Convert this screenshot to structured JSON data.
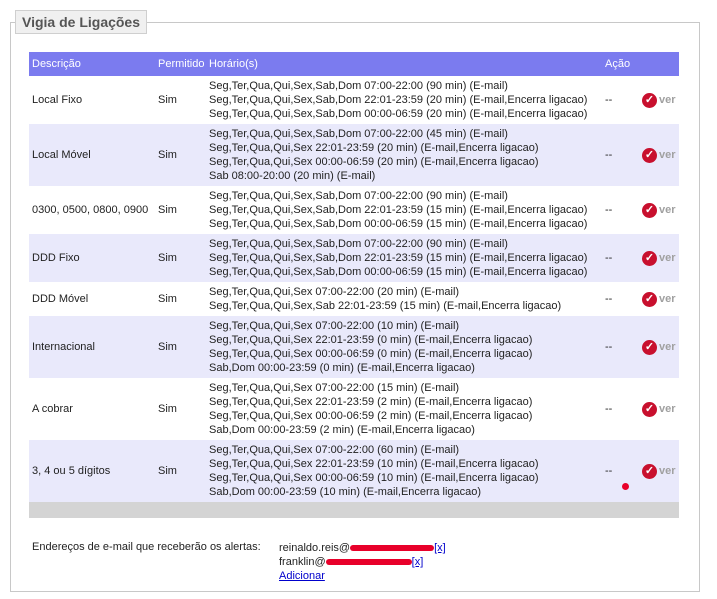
{
  "title": "Vigia de Ligações",
  "headers": {
    "descricao": "Descrição",
    "permitido": "Permitido",
    "horarios": "Horário(s)",
    "acao": "Ação"
  },
  "rows": [
    {
      "desc": "Local Fixo",
      "perm": "Sim",
      "h": [
        "Seg,Ter,Qua,Qui,Sex,Sab,Dom 07:00-22:00 (90 min) (E-mail)",
        "Seg,Ter,Qua,Qui,Sex,Sab,Dom 22:01-23:59 (20 min) (E-mail,Encerra ligacao)",
        "Seg,Ter,Qua,Qui,Sex,Sab,Dom 00:00-06:59 (20 min) (E-mail,Encerra ligacao)"
      ],
      "acao": "--",
      "ver": "ver"
    },
    {
      "desc": "Local Móvel",
      "perm": "Sim",
      "h": [
        "Seg,Ter,Qua,Qui,Sex,Sab,Dom 07:00-22:00 (45 min) (E-mail)",
        "Seg,Ter,Qua,Qui,Sex 22:01-23:59 (20 min) (E-mail,Encerra ligacao)",
        "Seg,Ter,Qua,Qui,Sex 00:00-06:59 (20 min) (E-mail,Encerra ligacao)",
        "Sab 08:00-20:00 (20 min) (E-mail)"
      ],
      "acao": "--",
      "ver": "ver"
    },
    {
      "desc": "0300, 0500, 0800, 0900",
      "perm": "Sim",
      "h": [
        "Seg,Ter,Qua,Qui,Sex,Sab,Dom 07:00-22:00 (90 min) (E-mail)",
        "Seg,Ter,Qua,Qui,Sex,Sab,Dom 22:01-23:59 (15 min) (E-mail,Encerra ligacao)",
        "Seg,Ter,Qua,Qui,Sex,Sab,Dom 00:00-06:59 (15 min) (E-mail,Encerra ligacao)"
      ],
      "acao": "--",
      "ver": "ver"
    },
    {
      "desc": "DDD Fixo",
      "perm": "Sim",
      "h": [
        "Seg,Ter,Qua,Qui,Sex,Sab,Dom 07:00-22:00 (90 min) (E-mail)",
        "Seg,Ter,Qua,Qui,Sex,Sab,Dom 22:01-23:59 (15 min) (E-mail,Encerra ligacao)",
        "Seg,Ter,Qua,Qui,Sex,Sab,Dom 00:00-06:59 (15 min) (E-mail,Encerra ligacao)"
      ],
      "acao": "--",
      "ver": "ver"
    },
    {
      "desc": "DDD Móvel",
      "perm": "Sim",
      "h": [
        "Seg,Ter,Qua,Qui,Sex 07:00-22:00 (20 min) (E-mail)",
        "Seg,Ter,Qua,Qui,Sex,Sab 22:01-23:59 (15 min) (E-mail,Encerra ligacao)"
      ],
      "acao": "--",
      "ver": "ver"
    },
    {
      "desc": "Internacional",
      "perm": "Sim",
      "h": [
        "Seg,Ter,Qua,Qui,Sex 07:00-22:00 (10 min) (E-mail)",
        "Seg,Ter,Qua,Qui,Sex 22:01-23:59 (0 min) (E-mail,Encerra ligacao)",
        "Seg,Ter,Qua,Qui,Sex 00:00-06:59 (0 min) (E-mail,Encerra ligacao)",
        "Sab,Dom 00:00-23:59 (0 min) (E-mail,Encerra ligacao)"
      ],
      "acao": "--",
      "ver": "ver"
    },
    {
      "desc": "A cobrar",
      "perm": "Sim",
      "h": [
        "Seg,Ter,Qua,Qui,Sex 07:00-22:00 (15 min) (E-mail)",
        "Seg,Ter,Qua,Qui,Sex 22:01-23:59 (2 min) (E-mail,Encerra ligacao)",
        "Seg,Ter,Qua,Qui,Sex 00:00-06:59 (2 min) (E-mail,Encerra ligacao)",
        "Sab,Dom 00:00-23:59 (2 min) (E-mail,Encerra ligacao)"
      ],
      "acao": "--",
      "ver": "ver"
    },
    {
      "desc": "3, 4 ou 5 dígitos",
      "perm": "Sim",
      "h": [
        "Seg,Ter,Qua,Qui,Sex 07:00-22:00 (60 min) (E-mail)",
        "Seg,Ter,Qua,Qui,Sex 22:01-23:59 (10 min) (E-mail,Encerra ligacao)",
        "Seg,Ter,Qua,Qui,Sex 00:00-06:59 (10 min) (E-mail,Encerra ligacao)",
        "Sab,Dom 00:00-23:59 (10 min) (E-mail,Encerra ligacao)"
      ],
      "acao": "--",
      "ver": "ver"
    }
  ],
  "emails": {
    "label": "Endereços de e-mail que receberão os alertas:",
    "items": [
      {
        "visible": "reinaldo.reis@",
        "remove": "[x]"
      },
      {
        "visible": "franklin@",
        "remove": "[x]"
      }
    ],
    "add": "Adicionar"
  },
  "colors": {
    "header_bg": "#7b7bef",
    "alt_row": "#e9e9fb",
    "redaction": "#e8002a",
    "check": "#c8102e"
  }
}
